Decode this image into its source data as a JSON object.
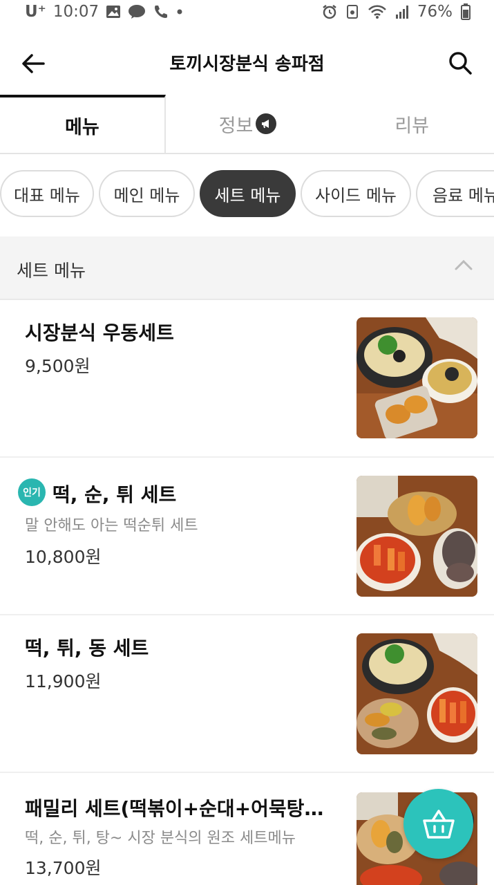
{
  "status_bar": {
    "carrier": "U⁺",
    "time": "10:07",
    "battery": "76%"
  },
  "header": {
    "title": "토끼시장분식 송파점"
  },
  "tabs": [
    {
      "label": "메뉴",
      "active": true
    },
    {
      "label": "정보",
      "active": false
    },
    {
      "label": "리뷰",
      "active": false
    }
  ],
  "chips": [
    {
      "label": "대표 메뉴",
      "selected": false
    },
    {
      "label": "메인 메뉴",
      "selected": false
    },
    {
      "label": "세트 메뉴",
      "selected": true
    },
    {
      "label": "사이드 메뉴",
      "selected": false
    },
    {
      "label": "음료 메뉴",
      "selected": false
    }
  ],
  "section": {
    "title": "세트 메뉴"
  },
  "items": [
    {
      "name": "시장분식 우동세트",
      "description": "",
      "price": "9,500원",
      "badge": ""
    },
    {
      "name": "떡, 순, 튀 세트",
      "description": "말 안해도 아는 떡순튀 세트",
      "price": "10,800원",
      "badge": "인기"
    },
    {
      "name": "떡, 튀, 동 세트",
      "description": "",
      "price": "11,900원",
      "badge": ""
    },
    {
      "name": "패밀리 세트(떡볶이+순대+어묵탕+모...",
      "description": "떡, 순, 튀, 탕~ 시장 분식의 원조 세트메뉴",
      "price": "13,700원",
      "badge": ""
    }
  ],
  "colors": {
    "accent": "#2cc3bb",
    "selected_chip": "#3a3a3a"
  }
}
